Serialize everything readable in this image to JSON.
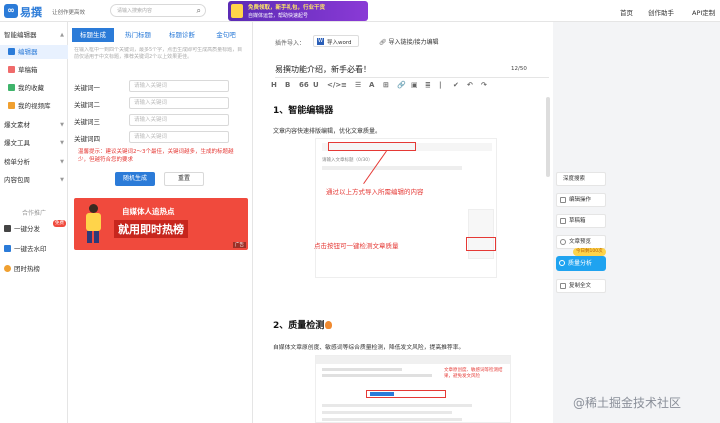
{
  "header": {
    "logo_text": "易撰",
    "tagline": "让创作更高效",
    "search_placeholder": "请输入搜索内容",
    "banner_line1": "免费领取，新手礼包，行业干货",
    "banner_line2": "自媒体运营，帮助快速起号",
    "nav": [
      "首页",
      "创作助手",
      "API定制"
    ]
  },
  "sidebar": {
    "items": [
      {
        "label": "智能编辑器",
        "icon": "editor-icon",
        "type": "group"
      },
      {
        "label": "编辑器",
        "icon": "document-icon",
        "type": "item",
        "active": true
      },
      {
        "label": "草稿箱",
        "icon": "draft-icon",
        "type": "item"
      },
      {
        "label": "我的收藏",
        "icon": "star-icon",
        "type": "item"
      },
      {
        "label": "我的视频库",
        "icon": "video-icon",
        "type": "item"
      },
      {
        "label": "爆文素材",
        "icon": "material-icon",
        "type": "group"
      },
      {
        "label": "爆文工具",
        "icon": "tool-icon",
        "type": "group"
      },
      {
        "label": "榜单分析",
        "icon": "chart-icon",
        "type": "group"
      },
      {
        "label": "内容包周",
        "icon": "package-icon",
        "type": "group"
      }
    ],
    "promo_label": "合作推广",
    "extra": [
      {
        "label": "一键分发",
        "badge": "免费"
      },
      {
        "label": "一键去水印"
      },
      {
        "label": "团时热榜"
      }
    ]
  },
  "leftpanel": {
    "tabs": [
      "标题生成",
      "热门标题",
      "标题诊断",
      "金句吧"
    ],
    "hint": "在输入框中一到四个关键词，最多5个字，点击生成即可生成高质量标题，目前仅适用于中文标题，推荐关键词2个以上效果更佳。",
    "keywords": [
      {
        "label": "关键词一",
        "placeholder": "请输入关键词"
      },
      {
        "label": "关键词二",
        "placeholder": "请输入关键词"
      },
      {
        "label": "关键词三",
        "placeholder": "请输入关键词"
      },
      {
        "label": "关键词四",
        "placeholder": "请输入关键词"
      }
    ],
    "warning": "温馨提示：建议关键词2～3个最佳，关键词越多，生成的标题越少，但越符合您的要求",
    "generate_label": "随机生成",
    "reset_label": "重置",
    "ad_line1": "自媒体人追热点",
    "ad_line2": "就用即时热榜",
    "ad_tag": "广告"
  },
  "editor": {
    "import_label": "插件导入：",
    "import_word": "导入word",
    "import_link": "导入链接/接力编辑",
    "title": "易撰功能介绍，新手必看！",
    "title_count": "12/50",
    "toolbar": [
      "H",
      "B",
      "66",
      "U",
      "</>",
      "≡",
      "☰",
      "A",
      "⊞",
      "🔗",
      "▣",
      "≣",
      "|",
      "✔",
      "↶",
      "↷"
    ],
    "section1_heading": "1、智能编辑器",
    "section1_text": "文章内容快速排版编辑，优化文章质量。",
    "shot1_caption": "通过以上方式导入所需编辑的内容",
    "shot1_caption2": "点击按钮可一键检测文章质量",
    "shot1_inner_title": "请输入文章标题（0/30）",
    "section2_heading": "2、质量检测",
    "section2_text": "自媒体文章原创度、敏感词等综合质量检测，降低发文风险，提高推荐率。",
    "shot2_caption": "文章原创度、敏感词等检测结果，避免发文风险"
  },
  "rightpanel": {
    "buttons": [
      "深度搜索",
      "编辑操作",
      "草稿箱",
      "文章预览"
    ],
    "badge": "今日剩100次",
    "primary": "质量分析",
    "extra": "复制全文"
  },
  "watermark": "@稀土掘金技术社区",
  "colors": {
    "accent": "#2b7bd8",
    "warning": "#e53935",
    "ad_bg": "#f04a3d",
    "ad_yellow": "#ffd44a"
  }
}
